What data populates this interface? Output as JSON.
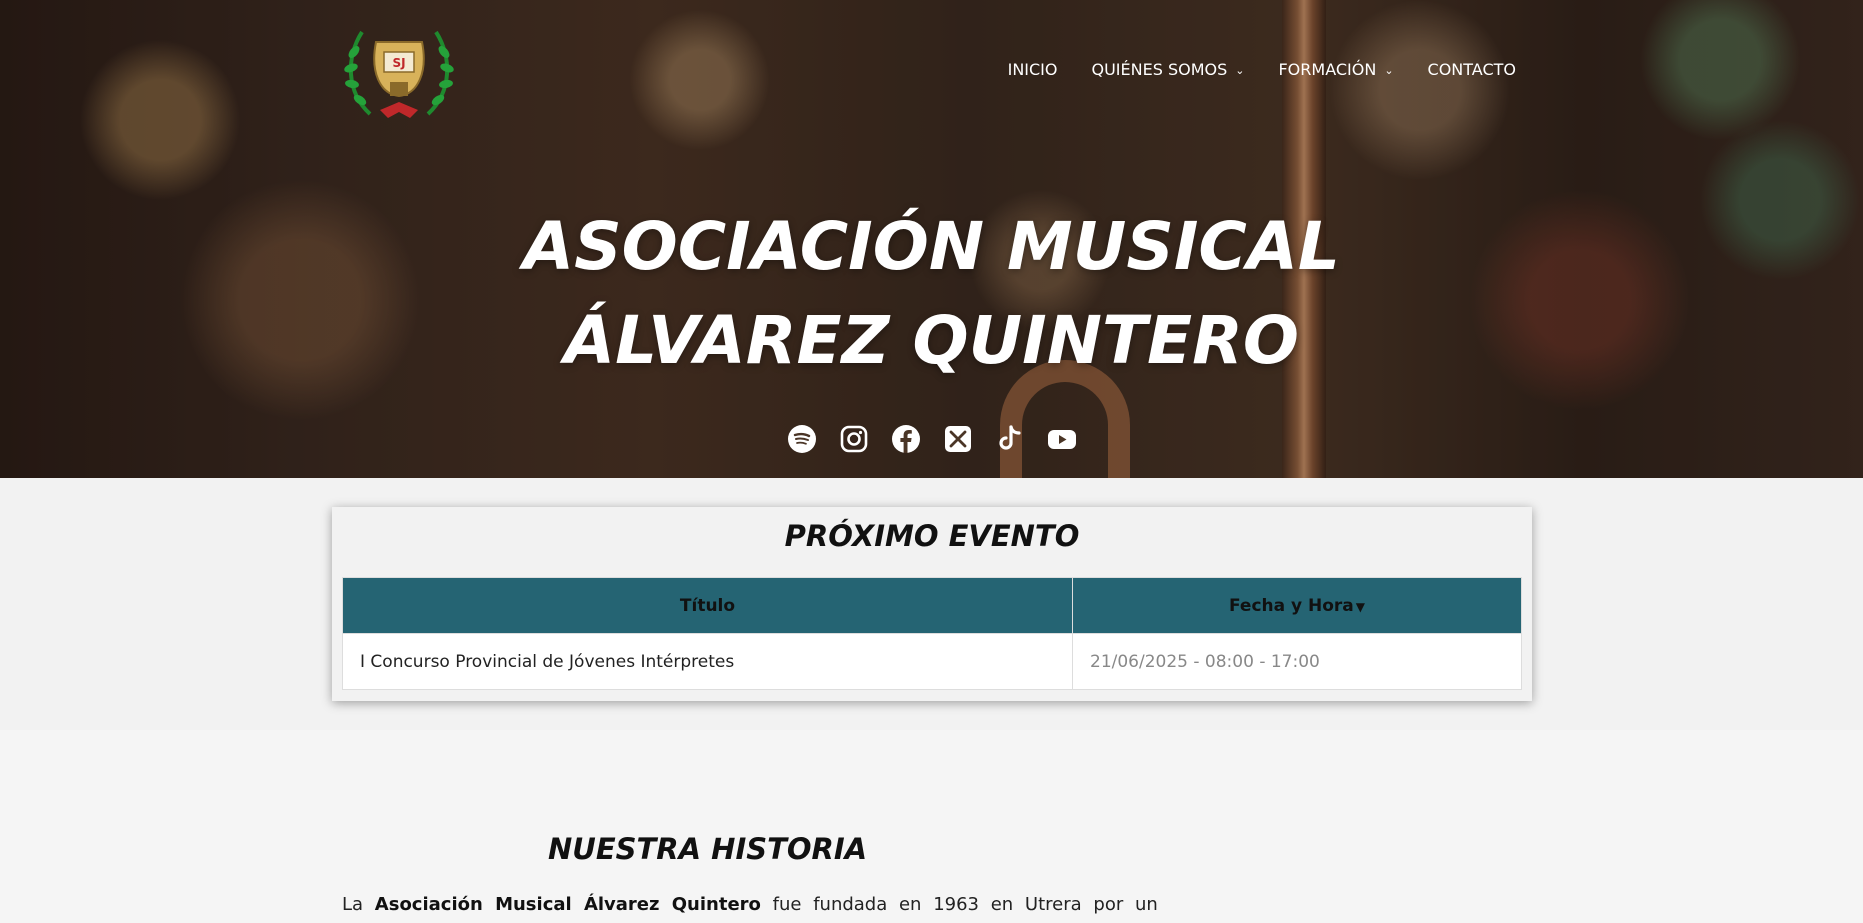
{
  "nav": {
    "items": [
      {
        "label": "INICIO",
        "dropdown": false
      },
      {
        "label": "QUIÉNES SOMOS",
        "dropdown": true
      },
      {
        "label": "FORMACIÓN",
        "dropdown": true
      },
      {
        "label": "CONTACTO",
        "dropdown": false
      }
    ]
  },
  "logo": {
    "letters": "SJ",
    "icon": "lyre-laurel-emblem"
  },
  "hero": {
    "title_line1": "ASOCIACIÓN MUSICAL",
    "title_line2": "ÁLVAREZ QUINTERO",
    "socials": [
      "spotify-icon",
      "instagram-icon",
      "facebook-icon",
      "x-icon",
      "tiktok-icon",
      "youtube-icon"
    ]
  },
  "event": {
    "heading": "PRÓXIMO EVENTO",
    "columns": [
      "Título",
      "Fecha y Hora"
    ],
    "rows": [
      {
        "title": "I Concurso Provincial de Jóvenes Intérpretes",
        "datetime": "21/06/2025 - 08:00 - 17:00"
      }
    ],
    "header_color": "#256473"
  },
  "history": {
    "heading": "NUESTRA HISTORIA",
    "intro_prefix": "La",
    "intro_bold": "Asociación Musical Álvarez Quintero",
    "intro_rest": "fue fundada en 1963 en Utrera por un"
  }
}
